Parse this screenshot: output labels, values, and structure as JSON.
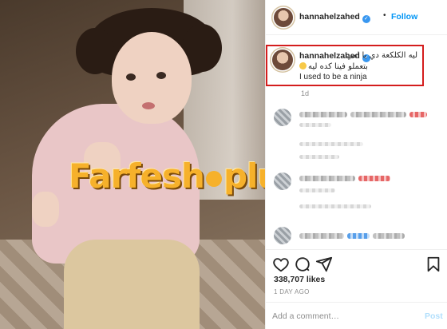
{
  "post": {
    "username": "hannahelzahed",
    "verified_icon": "verified-badge-icon",
    "separator": "•",
    "follow_label": "Follow"
  },
  "caption": {
    "username": "hannahelzahed",
    "arabic_line_1": "ليه الكلكعة دي يا امي",
    "arabic_line_2": "بتعملو فينا كده ليه",
    "english_line": "I used to be a ninja",
    "emoji_icon": "grinning-face-emoji",
    "age": "1d"
  },
  "photo": {
    "watermark_left": "Farfesh",
    "watermark_right": "plus.com"
  },
  "actions": {
    "icons": [
      "heart-icon",
      "comment-icon",
      "share-icon",
      "bookmark-icon"
    ]
  },
  "likes": "338,707 likes",
  "time_ago": "1 DAY AGO",
  "comment_box": {
    "placeholder": "Add a comment…",
    "post_label": "Post"
  },
  "colors": {
    "link_blue": "#0095f6",
    "verified_blue": "#3897f0",
    "highlight_red": "#d41d1d",
    "post_disabled": "#b2dffc",
    "watermark_orange": "#f6b12b"
  }
}
